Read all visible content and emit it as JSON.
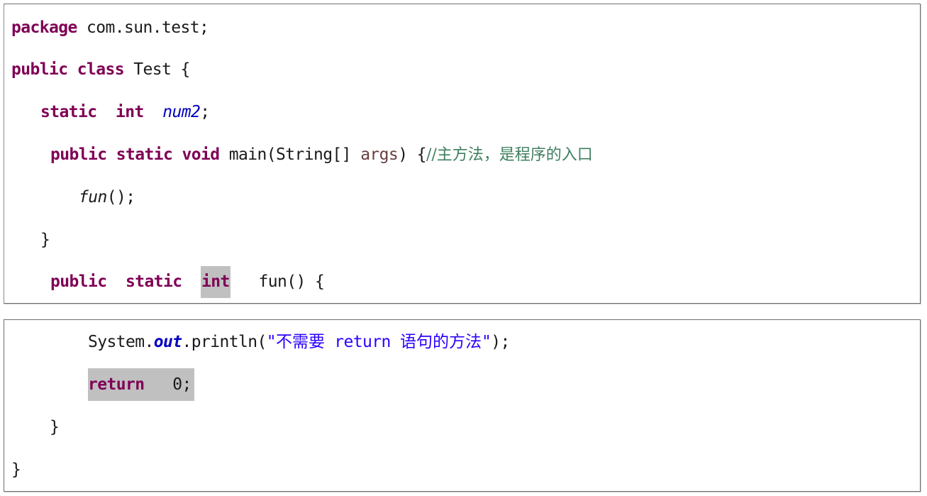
{
  "code_snippet": {
    "part1": {
      "line_package": {
        "keyword": "package",
        "rest": " com.sun.test;"
      },
      "line_class": {
        "kw_public": "public",
        "kw_class": "class",
        "rest": " Test {"
      },
      "line_field": {
        "kw_static": "static",
        "kw_int": "int",
        "field_name": "num2",
        "semicolon": ";"
      },
      "line_main": {
        "kw_public": "public",
        "kw_static": "static",
        "kw_void": "void",
        "signature": " main(String[] ",
        "param": "args",
        "close": ") {",
        "comment": "//主方法，是程序的入口"
      },
      "line_call": {
        "method": "fun",
        "rest": "();"
      },
      "line_close_main": "}",
      "line_fun": {
        "kw_public": "public",
        "kw_static": "static",
        "kw_int_highlighted": "int",
        "rest": "fun() {"
      }
    },
    "part2": {
      "line_println": {
        "prefix": "System.",
        "static_field": "out",
        "call": ".println(",
        "string_open": "\"",
        "string_cjk1": "不需要",
        "string_mid": " return ",
        "string_cjk2": "语句的方法",
        "string_close": "\"",
        "end": ");"
      },
      "line_return": {
        "kw_return": "return",
        "value": "   0;"
      },
      "line_close_fun": "}",
      "line_close_class": "}"
    },
    "colors": {
      "keyword": "#7f0055",
      "field": "#0000c0",
      "parameter": "#6a3e3e",
      "comment": "#3f7f5f",
      "string": "#2a00ff",
      "highlight": "#c0c0c0",
      "text": "#1a1a1a"
    }
  }
}
